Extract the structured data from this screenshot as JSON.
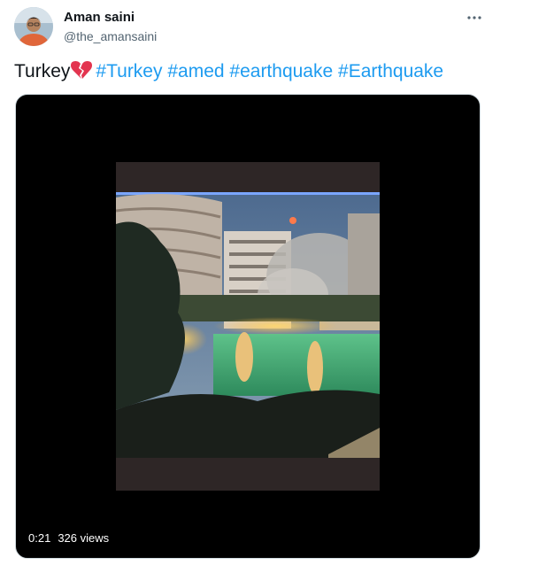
{
  "tweet": {
    "author": {
      "display_name": "Aman saini",
      "handle": "@the_amansaini",
      "avatar_icon": "user-avatar"
    },
    "more_icon": "more-options-icon",
    "text": "Turkey",
    "emoji": "broken-heart-icon",
    "hashtags": [
      "#Turkey",
      "#amed",
      "#earthquake",
      "#Earthquake"
    ],
    "hashtag_color": "#1d9bf0",
    "media": {
      "type": "video",
      "duration": "0:21",
      "views": "326 views"
    }
  }
}
